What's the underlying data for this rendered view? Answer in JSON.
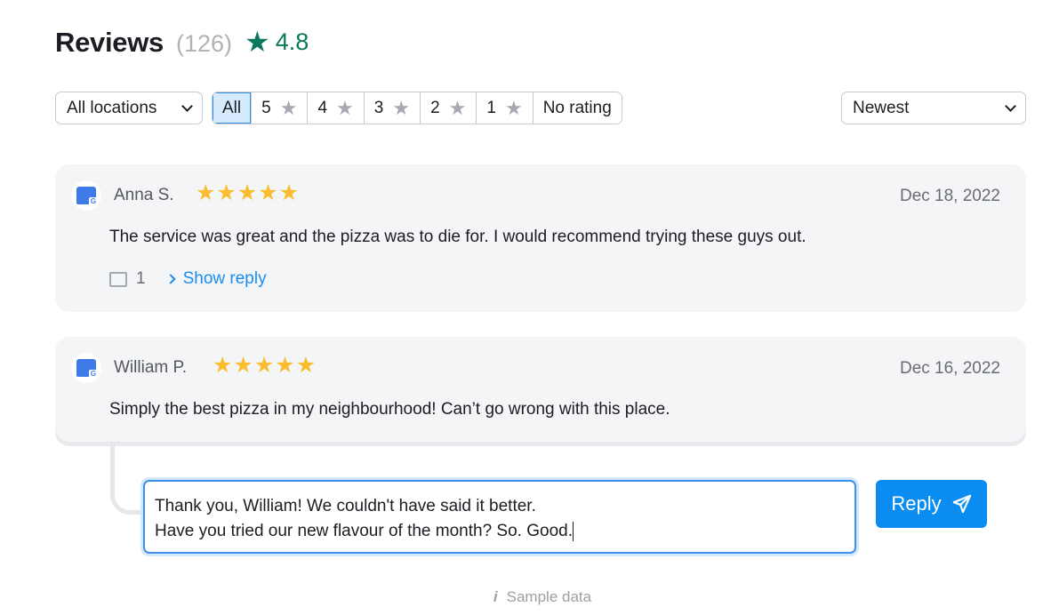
{
  "header": {
    "title": "Reviews",
    "count": "(126)",
    "rating": "4.8",
    "rating_color": "#0b7a5c",
    "star_icon": "star-icon"
  },
  "filters": {
    "location": "All locations",
    "ratings": [
      {
        "label": "All",
        "star": false,
        "active": true
      },
      {
        "label": "5",
        "star": true
      },
      {
        "label": "4",
        "star": true
      },
      {
        "label": "3",
        "star": true
      },
      {
        "label": "2",
        "star": true
      },
      {
        "label": "1",
        "star": true
      },
      {
        "label": "No rating",
        "star": false
      }
    ],
    "sort": "Newest"
  },
  "reviews": [
    {
      "name": "Anna S.",
      "rating": 5,
      "date": "Dec 18, 2022",
      "text": "The service was great and the pizza was to die for. I would recommend trying these guys out.",
      "reply_count": "1",
      "show_reply": "Show reply",
      "source_icon": "google-business-icon"
    },
    {
      "name": "William P.",
      "rating": 5,
      "date": "Dec 16, 2022",
      "text": "Simply the best pizza in my neighbourhood! Can’t go wrong with this place.",
      "source_icon": "google-business-icon"
    }
  ],
  "reply_box": {
    "value": "Thank you, William! We couldn't have said it better.\nHave you tried our new flavour of the month? So. Good.",
    "button": "Reply"
  },
  "footer": {
    "note": "Sample data"
  },
  "colors": {
    "accent": "#0a8cf0",
    "star": "#fbbd30",
    "card_bg": "#f4f5f7"
  }
}
